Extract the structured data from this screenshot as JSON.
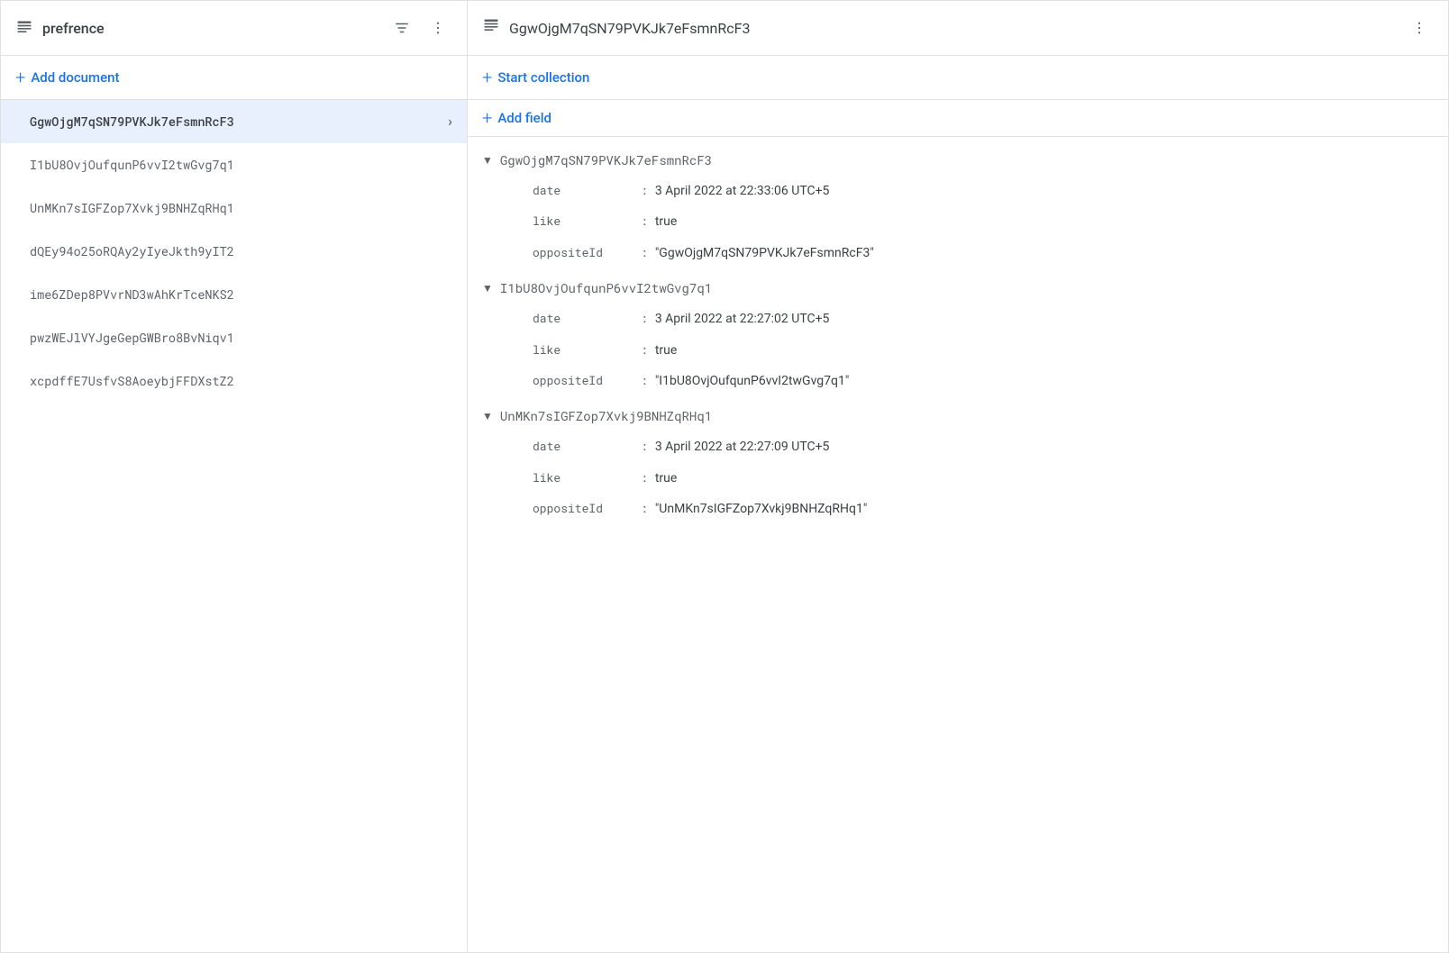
{
  "left_panel": {
    "title": "prefrence",
    "add_document_label": "Add document",
    "documents": [
      {
        "id": "GgwOjgM7qSN79PVKJk7eFsmnRcF3",
        "active": true
      },
      {
        "id": "I1bU8OvjOufqunP6vvI2twGvg7q1",
        "active": false
      },
      {
        "id": "UnMKn7sIGFZop7Xvkj9BNHZqRHq1",
        "active": false
      },
      {
        "id": "dQEy94o25oRQAy2yIyeJkth9yIT2",
        "active": false
      },
      {
        "id": "ime6ZDep8PVvrND3wAhKrTceNKS2",
        "active": false
      },
      {
        "id": "pwzWEJlVYJgeGepGWBro8BvNiqv1",
        "active": false
      },
      {
        "id": "xcpdffE7UsfvS8AoeybjFFDXstZ2",
        "active": false
      }
    ]
  },
  "right_panel": {
    "title": "GgwOjgM7qSN79PVKJk7eFsmnRcF3",
    "start_collection_label": "Start collection",
    "add_field_label": "Add field",
    "sections": [
      {
        "id": "GgwOjgM7qSN79PVKJk7eFsmnRcF3",
        "fields": [
          {
            "key": "date",
            "value": "3 April 2022 at 22:33:06 UTC+5",
            "type": "date"
          },
          {
            "key": "like",
            "value": "true",
            "type": "bool"
          },
          {
            "key": "oppositeId",
            "value": "\"GgwOjgM7qSN79PVKJk7eFsmnRcF3\"",
            "type": "string"
          }
        ]
      },
      {
        "id": "I1bU8OvjOufqunP6vvI2twGvg7q1",
        "fields": [
          {
            "key": "date",
            "value": "3 April 2022 at 22:27:02 UTC+5",
            "type": "date"
          },
          {
            "key": "like",
            "value": "true",
            "type": "bool"
          },
          {
            "key": "oppositeId",
            "value": "\"I1bU8OvjOufqunP6vvI2twGvg7q1\"",
            "type": "string"
          }
        ]
      },
      {
        "id": "UnMKn7sIGFZop7Xvkj9BNHZqRHq1",
        "fields": [
          {
            "key": "date",
            "value": "3 April 2022 at 22:27:09 UTC+5",
            "type": "date"
          },
          {
            "key": "like",
            "value": "true",
            "type": "bool"
          },
          {
            "key": "oppositeId",
            "value": "\"UnMKn7sIGFZop7Xvkj9BNHZqRHq1\"",
            "type": "string"
          }
        ]
      }
    ]
  },
  "icons": {
    "document": "▤",
    "filter": "≡",
    "more_vert": "⋮",
    "plus": "+",
    "chevron_right": "›",
    "triangle_down": "▼"
  }
}
